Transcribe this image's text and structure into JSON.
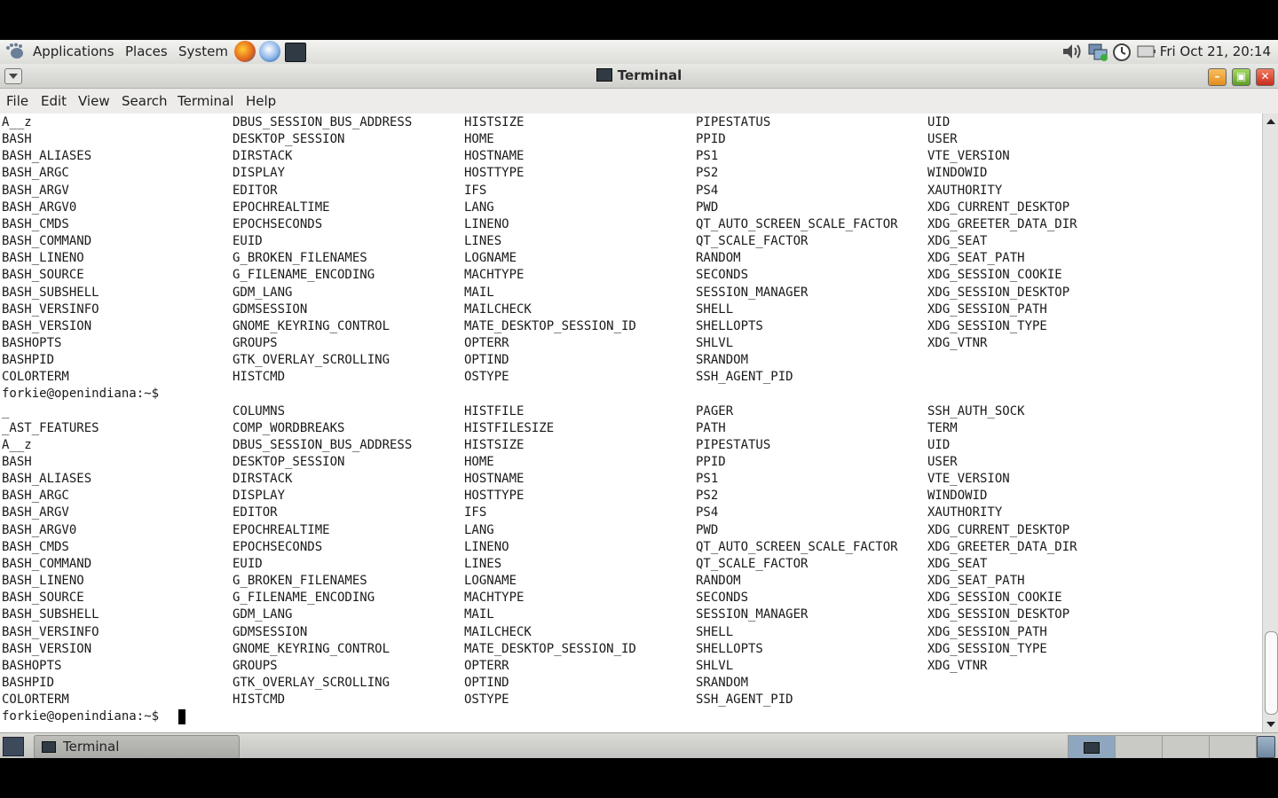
{
  "panel": {
    "menus": [
      "Applications",
      "Places",
      "System"
    ],
    "clock": "Fri Oct 21, 20:14"
  },
  "window": {
    "title": "Terminal"
  },
  "menubar": [
    "File",
    "Edit",
    "View",
    "Search",
    "Terminal",
    "Help"
  ],
  "terminal": {
    "lines": [
      [
        "A__z",
        "DBUS_SESSION_BUS_ADDRESS",
        "HISTSIZE",
        "PIPESTATUS",
        "UID"
      ],
      [
        "BASH",
        "DESKTOP_SESSION",
        "HOME",
        "PPID",
        "USER"
      ],
      [
        "BASH_ALIASES",
        "DIRSTACK",
        "HOSTNAME",
        "PS1",
        "VTE_VERSION"
      ],
      [
        "BASH_ARGC",
        "DISPLAY",
        "HOSTTYPE",
        "PS2",
        "WINDOWID"
      ],
      [
        "BASH_ARGV",
        "EDITOR",
        "IFS",
        "PS4",
        "XAUTHORITY"
      ],
      [
        "BASH_ARGV0",
        "EPOCHREALTIME",
        "LANG",
        "PWD",
        "XDG_CURRENT_DESKTOP"
      ],
      [
        "BASH_CMDS",
        "EPOCHSECONDS",
        "LINENO",
        "QT_AUTO_SCREEN_SCALE_FACTOR",
        "XDG_GREETER_DATA_DIR"
      ],
      [
        "BASH_COMMAND",
        "EUID",
        "LINES",
        "QT_SCALE_FACTOR",
        "XDG_SEAT"
      ],
      [
        "BASH_LINENO",
        "G_BROKEN_FILENAMES",
        "LOGNAME",
        "RANDOM",
        "XDG_SEAT_PATH"
      ],
      [
        "BASH_SOURCE",
        "G_FILENAME_ENCODING",
        "MACHTYPE",
        "SECONDS",
        "XDG_SESSION_COOKIE"
      ],
      [
        "BASH_SUBSHELL",
        "GDM_LANG",
        "MAIL",
        "SESSION_MANAGER",
        "XDG_SESSION_DESKTOP"
      ],
      [
        "BASH_VERSINFO",
        "GDMSESSION",
        "MAILCHECK",
        "SHELL",
        "XDG_SESSION_PATH"
      ],
      [
        "BASH_VERSION",
        "GNOME_KEYRING_CONTROL",
        "MATE_DESKTOP_SESSION_ID",
        "SHELLOPTS",
        "XDG_SESSION_TYPE"
      ],
      [
        "BASHOPTS",
        "GROUPS",
        "OPTERR",
        "SHLVL",
        "XDG_VTNR"
      ],
      [
        "BASHPID",
        "GTK_OVERLAY_SCROLLING",
        "OPTIND",
        "SRANDOM",
        ""
      ],
      [
        "COLORTERM",
        "HISTCMD",
        "OSTYPE",
        "SSH_AGENT_PID",
        ""
      ],
      [
        "forkie@openindiana:~$",
        "",
        "",
        "",
        ""
      ],
      [
        "_",
        "COLUMNS",
        "HISTFILE",
        "PAGER",
        "SSH_AUTH_SOCK"
      ],
      [
        "_AST_FEATURES",
        "COMP_WORDBREAKS",
        "HISTFILESIZE",
        "PATH",
        "TERM"
      ],
      [
        "A__z",
        "DBUS_SESSION_BUS_ADDRESS",
        "HISTSIZE",
        "PIPESTATUS",
        "UID"
      ],
      [
        "BASH",
        "DESKTOP_SESSION",
        "HOME",
        "PPID",
        "USER"
      ],
      [
        "BASH_ALIASES",
        "DIRSTACK",
        "HOSTNAME",
        "PS1",
        "VTE_VERSION"
      ],
      [
        "BASH_ARGC",
        "DISPLAY",
        "HOSTTYPE",
        "PS2",
        "WINDOWID"
      ],
      [
        "BASH_ARGV",
        "EDITOR",
        "IFS",
        "PS4",
        "XAUTHORITY"
      ],
      [
        "BASH_ARGV0",
        "EPOCHREALTIME",
        "LANG",
        "PWD",
        "XDG_CURRENT_DESKTOP"
      ],
      [
        "BASH_CMDS",
        "EPOCHSECONDS",
        "LINENO",
        "QT_AUTO_SCREEN_SCALE_FACTOR",
        "XDG_GREETER_DATA_DIR"
      ],
      [
        "BASH_COMMAND",
        "EUID",
        "LINES",
        "QT_SCALE_FACTOR",
        "XDG_SEAT"
      ],
      [
        "BASH_LINENO",
        "G_BROKEN_FILENAMES",
        "LOGNAME",
        "RANDOM",
        "XDG_SEAT_PATH"
      ],
      [
        "BASH_SOURCE",
        "G_FILENAME_ENCODING",
        "MACHTYPE",
        "SECONDS",
        "XDG_SESSION_COOKIE"
      ],
      [
        "BASH_SUBSHELL",
        "GDM_LANG",
        "MAIL",
        "SESSION_MANAGER",
        "XDG_SESSION_DESKTOP"
      ],
      [
        "BASH_VERSINFO",
        "GDMSESSION",
        "MAILCHECK",
        "SHELL",
        "XDG_SESSION_PATH"
      ],
      [
        "BASH_VERSION",
        "GNOME_KEYRING_CONTROL",
        "MATE_DESKTOP_SESSION_ID",
        "SHELLOPTS",
        "XDG_SESSION_TYPE"
      ],
      [
        "BASHOPTS",
        "GROUPS",
        "OPTERR",
        "SHLVL",
        "XDG_VTNR"
      ],
      [
        "BASHPID",
        "GTK_OVERLAY_SCROLLING",
        "OPTIND",
        "SRANDOM",
        ""
      ],
      [
        "COLORTERM",
        "HISTCMD",
        "OSTYPE",
        "SSH_AGENT_PID",
        ""
      ],
      [
        "forkie@openindiana:~$",
        "",
        "",
        "",
        ""
      ]
    ]
  },
  "taskbar": {
    "task_label": "Terminal"
  },
  "colors": {
    "accent_minimize": "#f0a030",
    "accent_maximize": "#7cbf3a",
    "accent_close": "#e2432e",
    "terminal_bg": "#ffffff"
  },
  "icons": [
    "foot-icon",
    "firefox-icon",
    "thunderbird-icon",
    "terminal-launcher-icon",
    "volume-icon",
    "network-icon",
    "clock-icon",
    "battery-icon",
    "trash-icon"
  ]
}
